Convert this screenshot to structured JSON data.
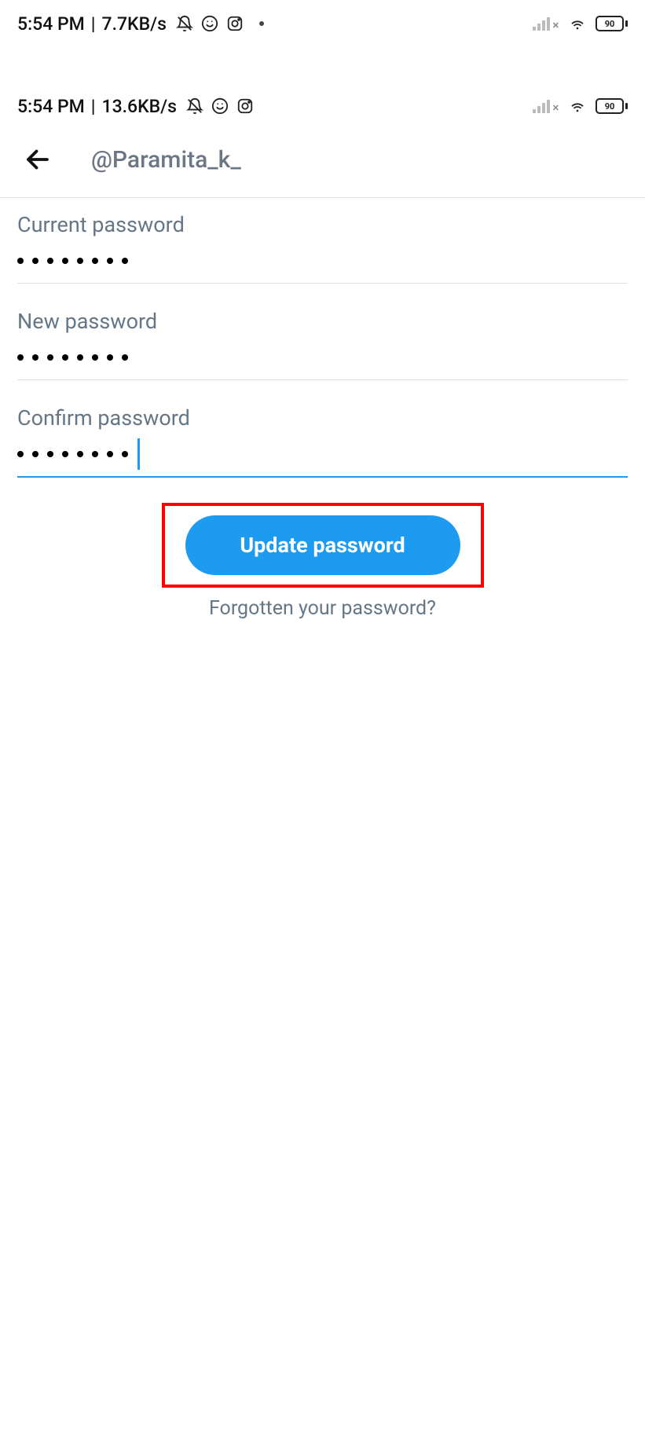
{
  "outer_status_bar": {
    "time": "5:54 PM",
    "data_rate": "7.7KB/s",
    "battery_level": "90"
  },
  "inner_status_bar": {
    "time": "5:54 PM",
    "data_rate": "13.6KB/s",
    "battery_level": "90"
  },
  "header": {
    "username": "@Paramita_k_"
  },
  "fields": {
    "current": {
      "label": "Current password",
      "mask_count": 8
    },
    "new": {
      "label": "New password",
      "mask_count": 8
    },
    "confirm": {
      "label": "Confirm password",
      "mask_count": 8,
      "has_cursor": true
    }
  },
  "buttons": {
    "update": "Update password",
    "forgot": "Forgotten your password?"
  },
  "highlight": {
    "target": "update-button"
  }
}
